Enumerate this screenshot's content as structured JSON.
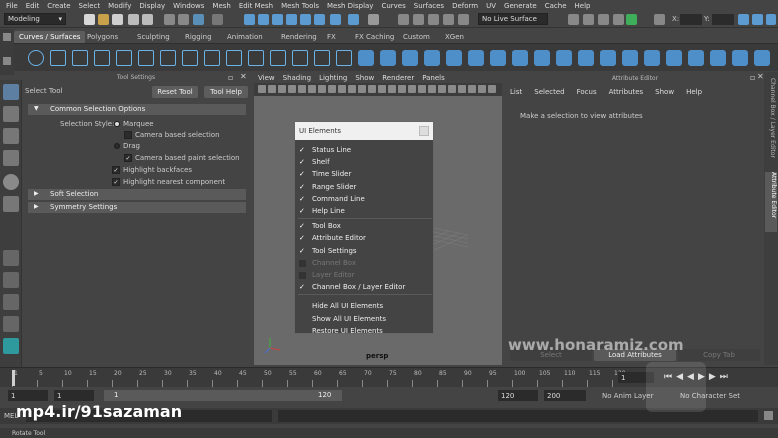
{
  "menubar": {
    "items": [
      "File",
      "Edit",
      "Create",
      "Select",
      "Modify",
      "Display",
      "Windows",
      "Mesh",
      "Edit Mesh",
      "Mesh Tools",
      "Mesh Display",
      "Curves",
      "Surfaces",
      "Deform",
      "UV",
      "Generate",
      "Cache",
      "Help"
    ]
  },
  "statusline": {
    "mode": "Modeling",
    "live_surface": "No Live Surface",
    "x_label": "X:",
    "y_label": "Y:",
    "z_label": "Z:"
  },
  "shelf": {
    "tabs": [
      "Curves / Surfaces",
      "Polygons",
      "Sculpting",
      "Rigging",
      "Animation",
      "Rendering",
      "FX",
      "FX Caching",
      "Custom",
      "XGen"
    ],
    "active_tab": 0
  },
  "tool_settings": {
    "panel_title": "Tool Settings",
    "tool_name": "Select Tool",
    "reset_button": "Reset Tool",
    "help_button": "Tool Help",
    "sections": {
      "common": "Common Selection Options",
      "soft": "Soft Selection",
      "symmetry": "Symmetry Settings"
    },
    "selection_style_label": "Selection Style:",
    "options": {
      "marquee": "Marquee",
      "camera_based_selection": "Camera based selection",
      "drag": "Drag",
      "camera_based_paint": "Camera based paint selection",
      "highlight_backfaces": "Highlight backfaces",
      "highlight_nearest": "Highlight nearest component"
    }
  },
  "viewport": {
    "menu": [
      "View",
      "Shading",
      "Lighting",
      "Show",
      "Renderer",
      "Panels"
    ],
    "camera_label": "persp"
  },
  "ui_elements_popup": {
    "title": "UI Elements",
    "items": [
      {
        "label": "Status Line",
        "checked": true,
        "disabled": false
      },
      {
        "label": "Shelf",
        "checked": true,
        "disabled": false
      },
      {
        "label": "Time Slider",
        "checked": true,
        "disabled": false
      },
      {
        "label": "Range Slider",
        "checked": true,
        "disabled": false
      },
      {
        "label": "Command Line",
        "checked": true,
        "disabled": false
      },
      {
        "label": "Help Line",
        "checked": true,
        "disabled": false
      },
      {
        "label": "Tool Box",
        "checked": true,
        "disabled": false
      },
      {
        "label": "Attribute Editor",
        "checked": true,
        "disabled": false
      },
      {
        "label": "Tool Settings",
        "checked": true,
        "disabled": false
      },
      {
        "label": "Channel Box",
        "checked": false,
        "disabled": true
      },
      {
        "label": "Layer Editor",
        "checked": false,
        "disabled": true
      },
      {
        "label": "Channel Box / Layer Editor",
        "checked": true,
        "disabled": false
      }
    ],
    "actions": [
      "Hide All UI Elements",
      "Show All UI Elements",
      "Restore UI Elements"
    ]
  },
  "attribute_editor": {
    "panel_title": "Attribute Editor",
    "menu": [
      "List",
      "Selected",
      "Focus",
      "Attributes",
      "Show",
      "Help"
    ],
    "hint": "Make a selection to view attributes",
    "bottom_buttons": [
      "Select",
      "Load Attributes",
      "Copy Tab"
    ]
  },
  "right_tabs": {
    "channel_box_tab": "Channel Box / Layer Editor",
    "attribute_tab": "Attribute Editor"
  },
  "timeline": {
    "ticks": [
      "1",
      "5",
      "10",
      "15",
      "20",
      "25",
      "30",
      "35",
      "40",
      "45",
      "50",
      "55",
      "60",
      "65",
      "70",
      "75",
      "80",
      "85",
      "90",
      "95",
      "100",
      "105",
      "110",
      "115",
      "120"
    ],
    "current_frame": "1"
  },
  "range": {
    "start": "1",
    "inner_start": "1",
    "slider_start": "1",
    "slider_end": "120",
    "end": "120",
    "anim_end": "200",
    "anim_layer": "No Anim Layer",
    "char_set": "No Character Set"
  },
  "cmd": {
    "label": "MEL"
  },
  "help": {
    "text": "Rotate Tool"
  },
  "watermarks": {
    "site": "www.honaramiz.com",
    "source": "mp4.ir/91sazaman"
  }
}
